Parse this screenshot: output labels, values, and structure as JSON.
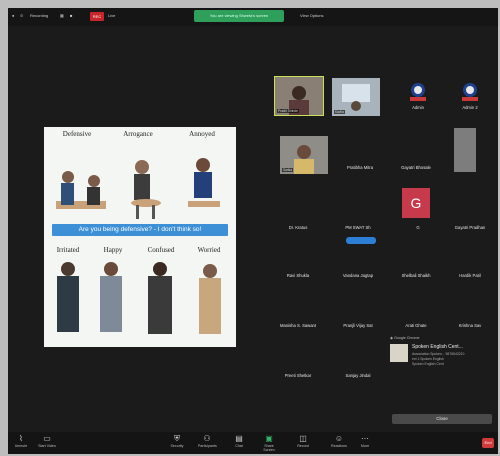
{
  "topbar": {
    "title": "Recording",
    "rec_label": "REC",
    "rec_text": "Live",
    "share_banner": "You are viewing Shweta's screen",
    "view_options": "View Options"
  },
  "shared": {
    "top_labels": [
      "Defensive",
      "Arrogance",
      "Annoyed"
    ],
    "banner": "Are you being defensive? - I don't think so!",
    "bottom_labels": [
      "Irritated",
      "Happy",
      "Confused",
      "Worried"
    ]
  },
  "participants": [
    {
      "name": "Prachi Shinde"
    },
    {
      "name": "Kavita"
    },
    {
      "name": "Admin"
    },
    {
      "name": "Admin 2"
    },
    {
      "name": "Sarika"
    },
    {
      "name": "Pratibha Mitra"
    },
    {
      "name": "Gayatri Bhosale"
    },
    {
      "name": "Dr. Kratus"
    },
    {
      "name": "PM SWAT Sh"
    },
    {
      "name": "G",
      "initial": "G"
    },
    {
      "name": "Gayatri Pradhan"
    },
    {
      "name": "Ravi Shukla"
    },
    {
      "name": "Vandana Jagtap"
    },
    {
      "name": "Shelbali Shaikh"
    },
    {
      "name": "Hardik Patil"
    },
    {
      "name": "Manisha S. Sawant"
    },
    {
      "name": "Pranjli Vijay Sat"
    },
    {
      "name": "Arati Ghate"
    },
    {
      "name": "Krishna Sav"
    },
    {
      "name": "Preeti Shetkar"
    },
    {
      "name": "Sanjay Jindal"
    }
  ],
  "chat": {
    "header": "Google Chrome",
    "title": "Spoken English Cent...",
    "lines": [
      "Association Spoken... 9876543210",
      "ext 1 Spoken English",
      "Spoken English Cent"
    ],
    "close_label": "Close"
  },
  "bottombar": {
    "items": [
      {
        "label": "Unmute",
        "icon": "mic-icon"
      },
      {
        "label": "Start Video",
        "icon": "video-icon"
      },
      {
        "label": "Security",
        "icon": "shield-icon"
      },
      {
        "label": "Participants",
        "icon": "people-icon"
      },
      {
        "label": "Chat",
        "icon": "chat-icon"
      },
      {
        "label": "Share Screen",
        "icon": "share-icon"
      },
      {
        "label": "Record",
        "icon": "record-icon"
      },
      {
        "label": "Reactions",
        "icon": "reaction-icon"
      },
      {
        "label": "More",
        "icon": "more-icon"
      }
    ],
    "end_label": "End"
  },
  "colors": {
    "background": "#1b1b1b",
    "share": "#2fa05c",
    "record": "#c8242b",
    "banner": "#3d8fd6",
    "avatar": "#c63a4b"
  }
}
